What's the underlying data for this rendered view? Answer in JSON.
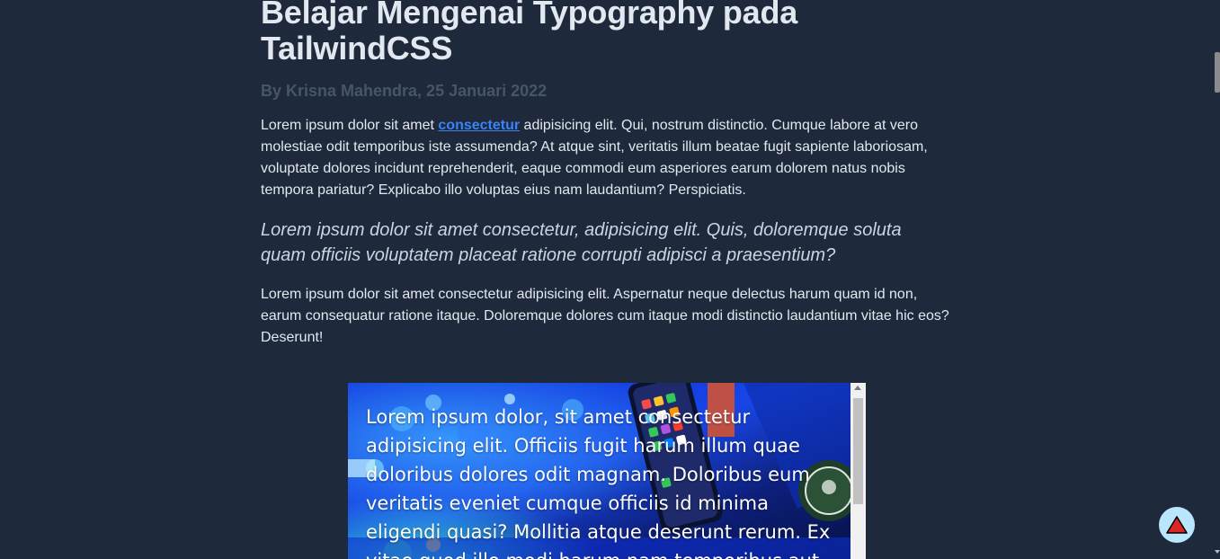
{
  "article": {
    "title": "Belajar Mengenai Typography pada TailwindCSS",
    "byline": "By Krisna Mahendra, 25 Januari 2022",
    "paragraph1": {
      "before_link": "Lorem ipsum dolor sit amet ",
      "link_text": "consectetur",
      "after_link": " adipisicing elit. Qui, nostrum distinctio. Cumque labore at vero molestiae odit temporibus iste assumenda? At atque sint, veritatis illum beatae fugit sapiente laboriosam, voluptate dolores incidunt reprehenderit, eaque commodi eum asperiores earum dolorem natus nobis tempora pariatur? Explicabo illo voluptas eius nam laudantium? Perspiciatis."
    },
    "quote": "Lorem ipsum dolor sit amet consectetur, adipisicing elit. Quis, doloremque soluta quam officiis voluptatem placeat ratione corrupti adipisci a praesentium?",
    "paragraph2": "Lorem ipsum dolor sit amet consectetur adipisicing elit. Aspernatur neque delectus harum quam id non, earum consequatur ratione itaque. Doloremque dolores cum itaque modi distinctio laudantium vitae hic eos? Deserunt!"
  },
  "media": {
    "overlay_text": "Lorem ipsum dolor, sit amet consectetur adipisicing elit. Officiis fugit harum illum quae doloribus dolores odit magnam. Doloribus eum veritatis eveniet cumque officiis id minima eligendi quasi? Mollitia atque deserunt rerum. Ex vitae quod illo modi harum nam temporibus aut",
    "image_icon": "phone-starbucks-photo"
  },
  "controls": {
    "scroll_top_icon": "triangle-up-icon"
  },
  "colors": {
    "background": "#1e293b",
    "text": "#e2e8f0",
    "byline": "#475569",
    "link": "#3b82f6",
    "scroll_top_bg": "#bae6fd",
    "scroll_top_icon": "#dc2626"
  }
}
